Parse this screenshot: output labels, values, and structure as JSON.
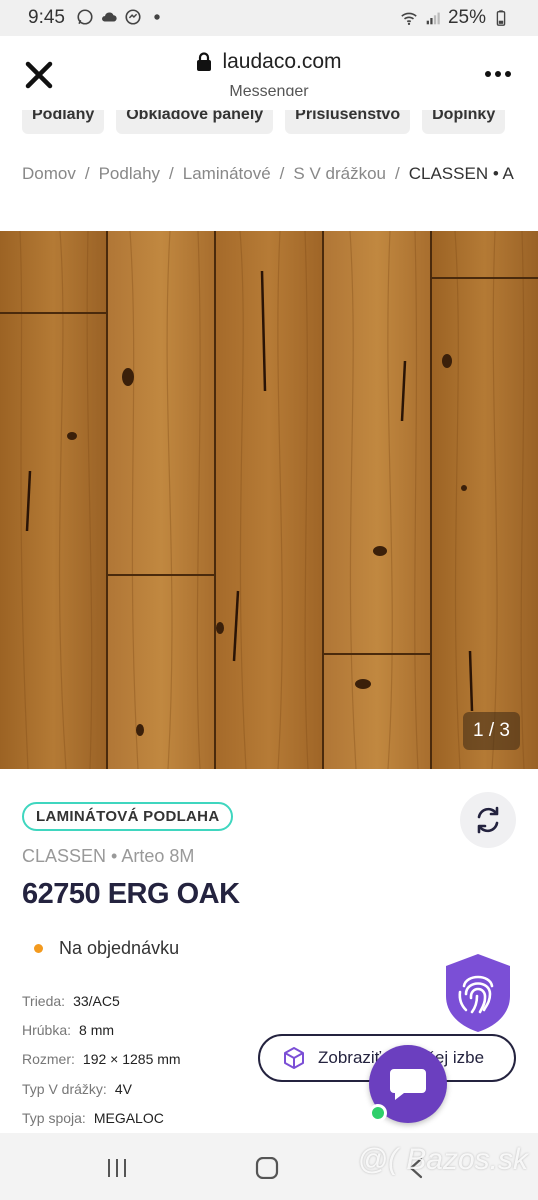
{
  "status_bar": {
    "time": "9:45",
    "battery": "25%",
    "icons_left": [
      "whatsapp-icon",
      "cloud-icon",
      "messenger-icon",
      "dot-icon"
    ],
    "icons_right": [
      "wifi-icon",
      "signal-icon",
      "battery-icon"
    ]
  },
  "browser": {
    "url": "laudaco.com",
    "app_name": "Messenger",
    "close_icon": "close-icon",
    "menu_icon": "more-icon"
  },
  "categories": [
    "Podlahy",
    "Obkladové panely",
    "Príslušenstvo",
    "Doplnky"
  ],
  "breadcrumb": {
    "items": [
      "Domov",
      "Podlahy",
      "Laminátové",
      "S V drážkou"
    ],
    "current": "CLASSEN • A",
    "separator": "/"
  },
  "gallery": {
    "counter": "1 / 3"
  },
  "product": {
    "tag": "LAMINÁTOVÁ PODLAHA",
    "brand": "CLASSEN • Arteo 8M",
    "name": "62750 ERG OAK",
    "availability": "Na objednávku",
    "availability_color": "#f39a1e",
    "accent_color": "#3fd6bf",
    "dark_color": "#24233f"
  },
  "specs": [
    {
      "label": "Trieda:",
      "value": "33/AC5"
    },
    {
      "label": "Hrúbka:",
      "value": "8 mm"
    },
    {
      "label": "Rozmer:",
      "value": "192 × 1285 mm"
    },
    {
      "label": "Typ V drážky:",
      "value": "4V"
    },
    {
      "label": "Typ spoja:",
      "value": "MEGALOC"
    }
  ],
  "room_button": {
    "label": "Zobraziť vo vašej izbe",
    "icon": "cube-icon"
  },
  "chat": {
    "icon": "chat-bubble-icon",
    "color": "#6b3fbf"
  },
  "nav": {
    "icons": [
      "recents-icon",
      "home-icon",
      "back-icon"
    ],
    "watermark": "@( Bazos.sk"
  }
}
